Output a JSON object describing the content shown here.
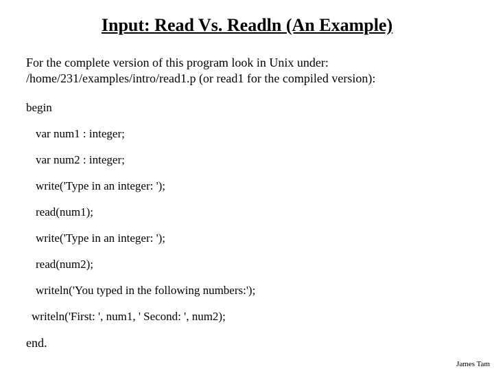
{
  "title": "Input: Read Vs. Readln (An Example)",
  "intro_line1": "For the complete version of this program look in Unix under:",
  "intro_line2": "/home/231/examples/intro/read1.p (or read1 for the compiled version):",
  "code": {
    "l0": "begin",
    "l1": "var num1 : integer;",
    "l2": "var num2 : integer;",
    "l3": "write('Type in an integer: ');",
    "l4": "read(num1);",
    "l5": "write('Type in an integer: ');",
    "l6": "read(num2);",
    "l7": "writeln('You typed in the following numbers:');",
    "l8": "writeln('First: ', num1, '  Second: ', num2);",
    "l9": "end."
  },
  "footer": "James Tam"
}
